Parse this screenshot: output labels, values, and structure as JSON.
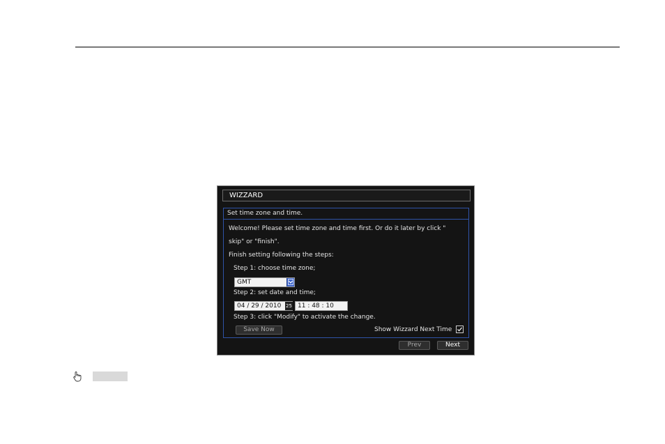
{
  "wizard": {
    "title": "WIZZARD",
    "section_header": "Set time zone and time.",
    "welcome_line1": "Welcome! Please set time zone and time first. Or do it later by click \"",
    "welcome_line2": "skip\" or \"finish\".",
    "finish_text": "Finish setting following the steps:",
    "step1_label": "Step 1: choose time zone;",
    "timezone_value": "GMT",
    "step2_label": "Step 2: set date and time;",
    "date_value": "04 / 29 / 2010",
    "calendar_label": "25",
    "time_value": "11  :  48  :  10",
    "step3_label": "Step 3: click \"Modify\" to activate the change.",
    "save_now_label": "Save Now",
    "show_next_label": "Show Wizzard Next Time",
    "show_next_checked": true,
    "prev_label": "Prev",
    "next_label": "Next"
  },
  "colors": {
    "panel_border": "#2f53a8",
    "window_bg": "#141414",
    "dropdown_arrow": "#3a62c8"
  },
  "icons": {
    "pointer": "hand-pointer-icon",
    "dropdown": "chevron-down-icon",
    "checkbox": "checkmark-icon",
    "calendar": "calendar-icon"
  }
}
